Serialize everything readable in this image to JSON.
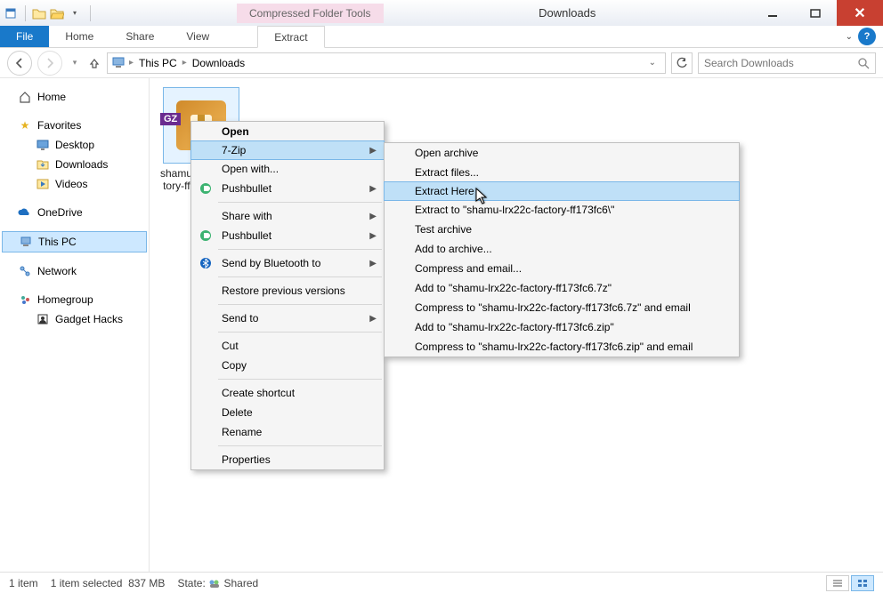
{
  "window": {
    "title": "Downloads",
    "tool_context": "Compressed Folder Tools"
  },
  "ribbon": {
    "file": "File",
    "tabs": [
      "Home",
      "Share",
      "View"
    ],
    "context_tab": "Extract"
  },
  "nav": {
    "segments": [
      "This PC",
      "Downloads"
    ],
    "search_placeholder": "Search Downloads"
  },
  "sidebar": {
    "home": "Home",
    "favorites": {
      "label": "Favorites",
      "items": [
        "Desktop",
        "Downloads",
        "Videos"
      ]
    },
    "onedrive": "OneDrive",
    "thispc": "This PC",
    "network": "Network",
    "homegroup": {
      "label": "Homegroup",
      "items": [
        "Gadget Hacks"
      ]
    }
  },
  "file": {
    "name_line1": "shamu-lrx22c-fac",
    "name_line2": "tory-ff173fc6.tgz"
  },
  "context_menu": {
    "open": "Open",
    "sevenzip": "7-Zip",
    "openwith": "Open with...",
    "pushbullet": "Pushbullet",
    "sharewith": "Share with",
    "pushbullet2": "Pushbullet",
    "sendbt": "Send by Bluetooth to",
    "restore": "Restore previous versions",
    "sendto": "Send to",
    "cut": "Cut",
    "copy": "Copy",
    "shortcut": "Create shortcut",
    "delete": "Delete",
    "rename": "Rename",
    "properties": "Properties"
  },
  "submenu": {
    "open_archive": "Open archive",
    "extract_files": "Extract files...",
    "extract_here": "Extract Here",
    "extract_to": "Extract to \"shamu-lrx22c-factory-ff173fc6\\\"",
    "test": "Test archive",
    "add_archive": "Add to archive...",
    "compress_email": "Compress and email...",
    "add_7z": "Add to \"shamu-lrx22c-factory-ff173fc6.7z\"",
    "compress_7z_email": "Compress to \"shamu-lrx22c-factory-ff173fc6.7z\" and email",
    "add_zip": "Add to \"shamu-lrx22c-factory-ff173fc6.zip\"",
    "compress_zip_email": "Compress to \"shamu-lrx22c-factory-ff173fc6.zip\" and email"
  },
  "status": {
    "count": "1 item",
    "selected": "1 item selected",
    "size": "837 MB",
    "state_label": "State:",
    "state_value": "Shared"
  }
}
